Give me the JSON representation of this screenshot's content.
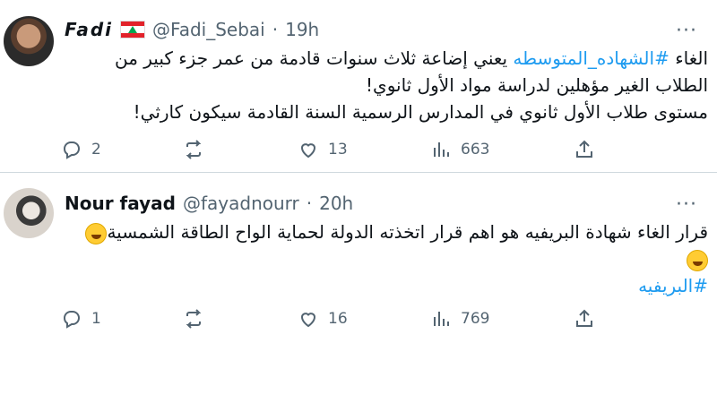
{
  "tweets": [
    {
      "name": "Fadi",
      "handle": "@Fadi_Sebai",
      "dot": "·",
      "time": "19h",
      "more": "···",
      "line1_prefix": "الغاء ",
      "hashtag": "#الشهاده_المتوسطه",
      "line1_suffix": " يعني إضاعة ثلاث سنوات قادمة من عمر جزء كبير من",
      "line2": "الطلاب الغير مؤهلين لدراسة مواد الأول ثانوي!",
      "line3": "مستوى طلاب  الأول ثانوي في المدارس الرسمية السنة القادمة سيكون كارثي!",
      "replies": "2",
      "retweets": "",
      "likes": "13",
      "views": "663"
    },
    {
      "name": "Nour fayad",
      "handle": "@fayadnourr",
      "dot": "·",
      "time": "20h",
      "more": "···",
      "line1": "قرار الغاء شهادة البريفيه هو اهم قرار اتخذته الدولة لحماية الواح الطاقة الشمسية",
      "hashtag": "#البريفيه",
      "replies": "1",
      "retweets": "",
      "likes": "16",
      "views": "769"
    }
  ],
  "icons": {
    "reply": "reply-icon",
    "retweet": "retweet-icon",
    "like": "heart-icon",
    "views": "views-icon",
    "share": "share-icon",
    "flag": "lebanon-flag-icon",
    "emoji": "rofl-emoji-icon"
  },
  "colors": {
    "hashtag": "#1d9bf0",
    "meta": "#536471",
    "text": "#0f1419",
    "separator": "#cfd9de"
  }
}
